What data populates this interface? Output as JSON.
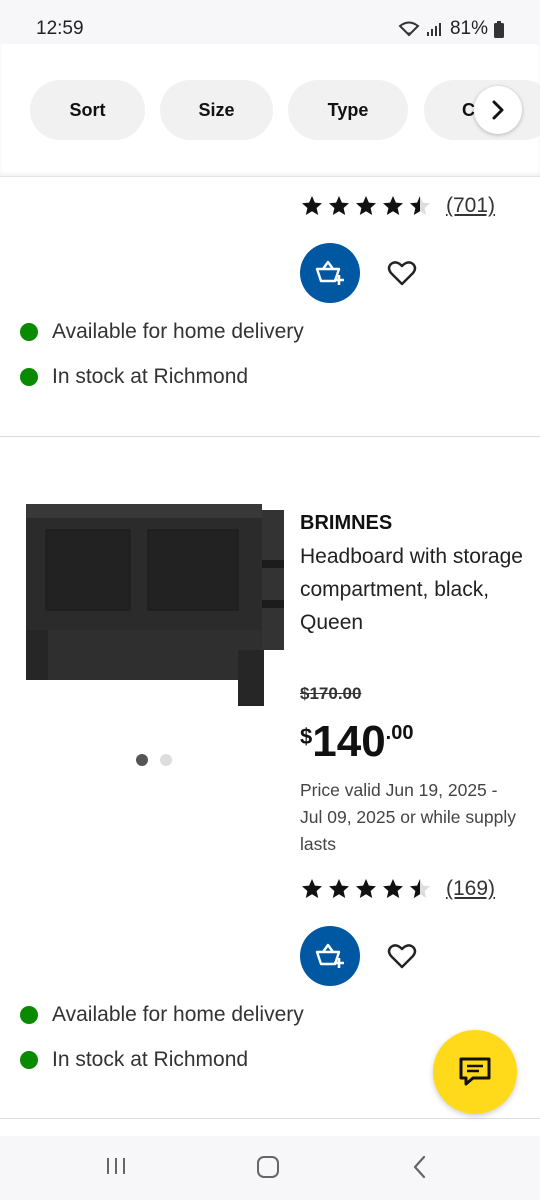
{
  "status": {
    "time": "12:59",
    "battery": "81%"
  },
  "filters": [
    {
      "label": "Sort"
    },
    {
      "label": "Size"
    },
    {
      "label": "Type"
    },
    {
      "label": "C"
    }
  ],
  "product1": {
    "rating_value": 4.5,
    "rating_count": "(701)",
    "availability": [
      "Available for home delivery",
      "In stock at Richmond"
    ]
  },
  "product2": {
    "brand": "BRIMNES",
    "description": "Headboard with storage compartment, black, Queen",
    "old_price": "$170.00",
    "price": {
      "currency": "$",
      "integer": "140",
      "decimal": ".00"
    },
    "validity": "Price valid Jun 19, 2025 - Jul 09, 2025 or while supply lasts",
    "rating_value": 4.5,
    "rating_count": "(169)",
    "carousel_images": 2,
    "carousel_active": 1,
    "availability": [
      "Available for home delivery",
      "In stock at Richmond"
    ]
  },
  "colors": {
    "accent_blue": "#0058a3",
    "stock_green": "#0a8a00",
    "chat_yellow": "#ffda1a"
  }
}
